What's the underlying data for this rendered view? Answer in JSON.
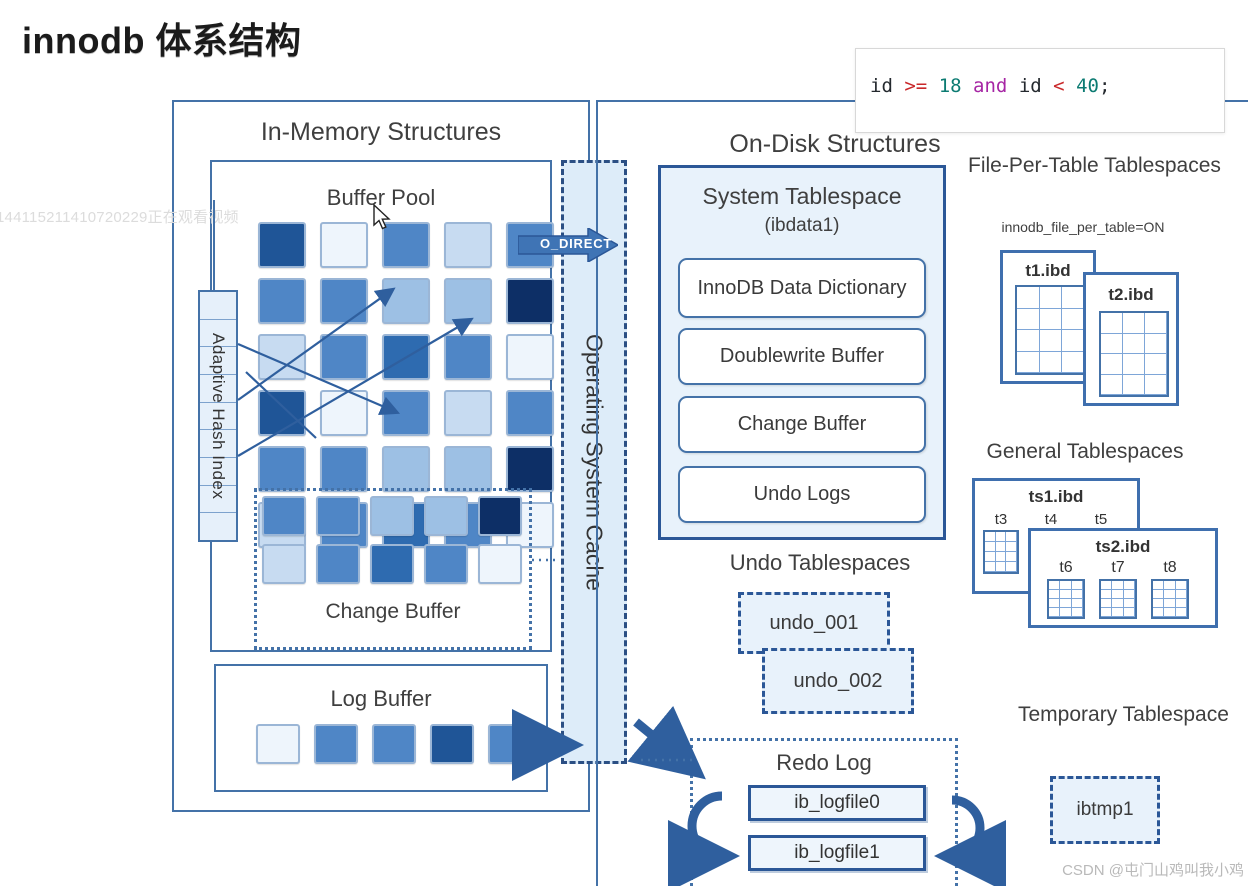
{
  "title": "innodb 体系结构",
  "code_overlay": {
    "tokens": [
      {
        "t": "id",
        "k": "id"
      },
      {
        "t": " ",
        "k": "pun"
      },
      {
        "t": ">=",
        "k": "op"
      },
      {
        "t": " ",
        "k": "pun"
      },
      {
        "t": "18",
        "k": "num"
      },
      {
        "t": " ",
        "k": "pun"
      },
      {
        "t": "and",
        "k": "kw"
      },
      {
        "t": " ",
        "k": "pun"
      },
      {
        "t": "id",
        "k": "id"
      },
      {
        "t": " ",
        "k": "pun"
      },
      {
        "t": "<",
        "k": "op"
      },
      {
        "t": " ",
        "k": "pun"
      },
      {
        "t": "40",
        "k": "num"
      },
      {
        "t": ";",
        "k": "pun"
      }
    ],
    "text": "id >= 18 and id < 40;"
  },
  "watermarks": {
    "left": "144115211410720229正在观看视频",
    "csdn": "CSDN @屯门山鸡叫我小鸡"
  },
  "in_memory": {
    "title": "In-Memory Structures",
    "buffer_pool": {
      "title": "Buffer Pool",
      "grid_rows": 6,
      "grid_cols": 5,
      "shades": [
        [
          6,
          1,
          4,
          2,
          4
        ],
        [
          4,
          4,
          3,
          3,
          7
        ],
        [
          2,
          4,
          5,
          4,
          1
        ],
        [
          6,
          1,
          4,
          2,
          4
        ],
        [
          4,
          4,
          3,
          3,
          7
        ],
        [
          2,
          4,
          5,
          4,
          1
        ]
      ]
    },
    "change_buffer": {
      "label": "Change Buffer",
      "shades": [
        [
          4,
          4,
          3,
          3,
          7
        ],
        [
          2,
          4,
          5,
          4,
          1
        ]
      ]
    },
    "adaptive_hash_index": {
      "label": "Adaptive Hash Index",
      "segments": 9
    },
    "log_buffer": {
      "title": "Log Buffer",
      "shades": [
        1,
        4,
        4,
        6,
        4
      ]
    }
  },
  "os_cache": {
    "label": "Operating System Cache",
    "o_direct_label": "O_DIRECT"
  },
  "on_disk": {
    "title": "On-Disk Structures",
    "system_tablespace": {
      "title": "System Tablespace",
      "subtitle": "(ibdata1)",
      "items": [
        "InnoDB Data Dictionary",
        "Doublewrite Buffer",
        "Change Buffer",
        "Undo Logs"
      ]
    },
    "file_per_table": {
      "title": "File-Per-Table Tablespaces",
      "subtitle": "innodb_file_per_table=ON",
      "files": [
        "t1.ibd",
        "t2.ibd"
      ]
    },
    "general_tablespaces": {
      "title": "General Tablespaces",
      "spaces": [
        {
          "file": "ts1.ibd",
          "tables": [
            "t3",
            "t4",
            "t5"
          ]
        },
        {
          "file": "ts2.ibd",
          "tables": [
            "t6",
            "t7",
            "t8"
          ]
        }
      ]
    },
    "undo_tablespaces": {
      "title": "Undo Tablespaces",
      "files": [
        "undo_001",
        "undo_002"
      ]
    },
    "redo_log": {
      "title": "Redo Log",
      "files": [
        "ib_logfile0",
        "ib_logfile1"
      ]
    },
    "temporary_tablespace": {
      "title": "Temporary Tablespace",
      "file": "ibtmp1"
    }
  },
  "colors": {
    "border": "#4472a8",
    "dark_border": "#2b5797",
    "fill_light": "#e8f2fb",
    "arrow": "#2f5f9e"
  }
}
